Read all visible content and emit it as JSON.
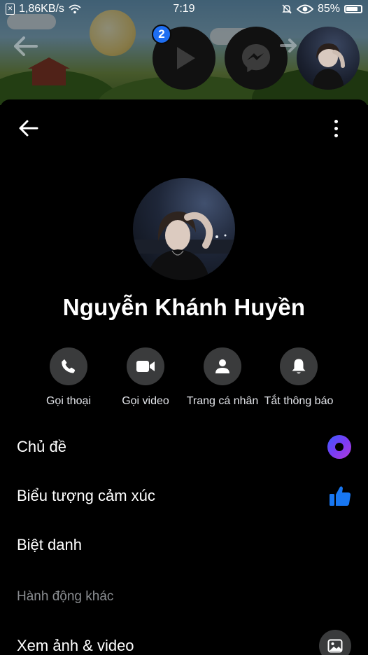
{
  "status_bar": {
    "network_speed": "1,86KB/s",
    "time": "7:19",
    "battery_percent": "85%",
    "battery_level": 0.85,
    "sim_icon": "sim-icon",
    "wifi_icon": "wifi-icon",
    "mute_icon": "bell-off-icon",
    "eye_icon": "eye-icon"
  },
  "chat_heads": {
    "badge_count": "2",
    "items": [
      {
        "icon": "play-icon"
      },
      {
        "icon": "messenger-icon"
      },
      {
        "icon": "avatar"
      }
    ]
  },
  "header": {
    "back_icon": "arrow-left-icon",
    "more_icon": "more-vertical-icon"
  },
  "profile": {
    "name": "Nguyễn Khánh Huyền"
  },
  "actions": [
    {
      "label": "Gọi thoại",
      "icon": "phone-icon"
    },
    {
      "label": "Gọi video",
      "icon": "video-icon"
    },
    {
      "label": "Trang cá nhân",
      "icon": "person-icon"
    },
    {
      "label": "Tắt thông báo",
      "icon": "bell-icon"
    }
  ],
  "settings": {
    "theme_label": "Chủ đề",
    "emoji_label": "Biểu tượng cảm xúc",
    "nickname_label": "Biệt danh",
    "section_more": "Hành động khác",
    "media_label": "Xem ảnh & video"
  },
  "colors": {
    "accent_blue": "#1e6ef2",
    "like_blue": "#1877f2",
    "button_bg": "#3a3b3c",
    "background": "#000000"
  }
}
